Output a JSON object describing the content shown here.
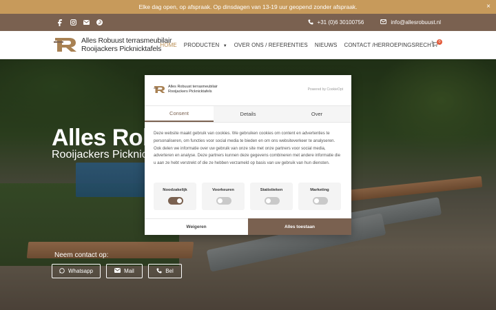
{
  "announcement": {
    "text": "Elke dag open, op afspraak. Op dinsdagen van 13-19 uur geopend zonder afspraak.",
    "close_label": "×"
  },
  "contactbar": {
    "social_icons": [
      "facebook-icon",
      "instagram-icon",
      "envelope-icon",
      "pinterest-icon"
    ],
    "phone": "+31 (0)6 30100756",
    "email": "info@allesrobuust.nl"
  },
  "header": {
    "logo_line1": "Alles Robuust terrasmeubilair",
    "logo_line2": "Rooijackers Picknicktafels",
    "nav": [
      {
        "label": "HOME"
      },
      {
        "label": "PRODUCTEN"
      },
      {
        "label": "OVER ONS / REFERENTIES"
      },
      {
        "label": "NIEUWS"
      },
      {
        "label": "CONTACT /HERROEPINGSRECHT"
      }
    ],
    "cart_count": "0"
  },
  "hero": {
    "title": "Alles Rob",
    "subtitle": "Rooijackers Picknic",
    "contact_label": "Neem contact op:",
    "buttons": [
      {
        "label": "Whatsapp",
        "icon": "whatsapp-icon"
      },
      {
        "label": "Mail",
        "icon": "envelope-icon"
      },
      {
        "label": "Bel",
        "icon": "phone-icon"
      }
    ]
  },
  "cookie": {
    "logo_line1": "Alles Robuust terrasmeubilair",
    "logo_line2": "Rooijackers Picknicktafels",
    "powered_by": "Powered by CookieOpt",
    "tabs": [
      "Consent",
      "Details",
      "Over"
    ],
    "body": "Deze website maakt gebruik van cookies. We gebruiken cookies om content en advertenties te personaliseren, om functies voor social media te bieden en om ons websiteverkeer te analyseren. Ook delen we informatie over uw gebruik van onze site met onze partners voor social media, adverteren en analyse. Deze partners kunnen deze gegevens combineren met andere informatie die u aan ze hebt verstrekt of die ze hebben verzameld op basis van uw gebruik van hun diensten.",
    "toggles": [
      {
        "label": "Noodzakelijk",
        "on": true
      },
      {
        "label": "Voorkeuren",
        "on": false
      },
      {
        "label": "Statistieken",
        "on": false
      },
      {
        "label": "Marketing",
        "on": false
      }
    ],
    "refuse_label": "Weigeren",
    "accept_label": "Alles toestaan"
  },
  "colors": {
    "announcement_bg": "#c79a5b",
    "contactbar_bg": "#7a6150",
    "accent": "#b78a4c",
    "accept_bg": "#7a6150"
  }
}
